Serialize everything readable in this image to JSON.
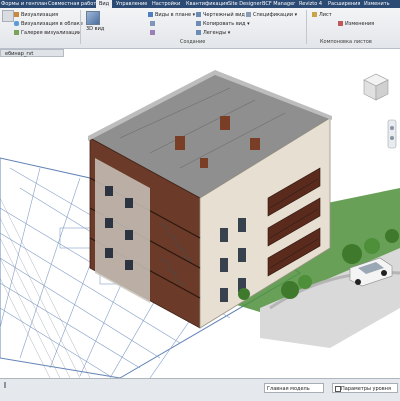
{
  "ribbon_tabs": [
    "Формы и генплан",
    "Совместная работа",
    "Вид",
    "Управление",
    "Настройки",
    "Квантификация",
    "Site Designer",
    "BCF Manager",
    "Revizto 4",
    "Расширения",
    "Изменить"
  ],
  "active_tab": "Вид",
  "ribbon": {
    "items": {
      "vis1": "Визуализация",
      "vis_cloud": "Визуализация в облаке",
      "gallery": "Галерея визуализации",
      "view3d": "3D вид",
      "plan_views": "Виды в плане",
      "draft_view": "Чертежный вид",
      "copy_view": "Копировать вид",
      "legends": "Легенды",
      "sheet": "Лист",
      "specs": "Спецификации",
      "revisions": "Изменения"
    },
    "groups": {
      "create": "Создание",
      "sheet_comp": "Компоновка листов"
    }
  },
  "document_tab": "ебинар_rvt",
  "status": {
    "model": "Главная модель",
    "params": "Параметры уровня"
  },
  "colors": {
    "title_bar": "#2b4a74",
    "ribbon_bg": "#e9ebee",
    "roof": "#8f8f8f",
    "brick": "#6b3a28",
    "plaster": "#e6dfd2",
    "grass": "#4e8f3a",
    "plan_lines": "#3d6fbf"
  }
}
